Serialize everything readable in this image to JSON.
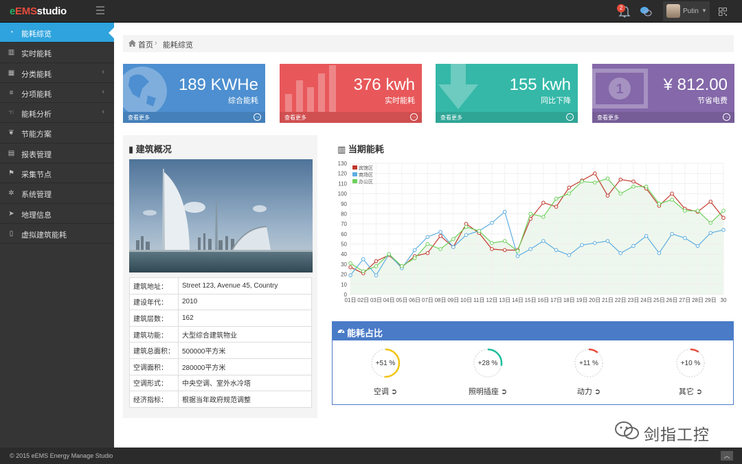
{
  "app": {
    "logo_e": "e",
    "logo_ems": "EMS",
    "logo_studio": "studio"
  },
  "topbar": {
    "notification_count": "2",
    "username": "Putin"
  },
  "sidebar": {
    "items": [
      {
        "label": "能耗综览",
        "icon": "dashboard-icon",
        "active": true
      },
      {
        "label": "实时能耗",
        "icon": "bar-chart-icon"
      },
      {
        "label": "分类能耗",
        "icon": "grid-icon",
        "chevron": "‹"
      },
      {
        "label": "分项能耗",
        "icon": "list-icon",
        "chevron": "‹"
      },
      {
        "label": "能耗分析",
        "icon": "hand-icon",
        "chevron": "‹"
      },
      {
        "label": "节能方案",
        "icon": "leaf-icon"
      },
      {
        "label": "报表管理",
        "icon": "table-icon"
      },
      {
        "label": "采集节点",
        "icon": "flag-icon"
      },
      {
        "label": "系统管理",
        "icon": "gear-icon"
      },
      {
        "label": "地理信息",
        "icon": "location-arrow-icon"
      },
      {
        "label": "虚拟建筑能耗",
        "icon": "building-icon"
      }
    ]
  },
  "breadcrumb": {
    "home": "首页",
    "separator": "›",
    "current": "能耗综览"
  },
  "tiles": [
    {
      "value": "189 KWHe",
      "label": "综合能耗",
      "more": "查看更多",
      "color": "#4d8fd0",
      "icon": "globe-icon"
    },
    {
      "value": "376 kwh",
      "label": "实时能耗",
      "more": "查看更多",
      "color": "#e8585a",
      "icon": "bar-chart-icon"
    },
    {
      "value": "155 kwh",
      "label": "同比下降",
      "more": "查看更多",
      "color": "#35b8a8",
      "icon": "arrow-down-icon"
    },
    {
      "value": "¥ 812.00",
      "label": "节省电费",
      "more": "查看更多",
      "color": "#8468a9",
      "icon": "money-icon"
    }
  ],
  "building": {
    "title": "建筑概况",
    "rows": [
      {
        "key": "建筑地址：",
        "value": "Street 123, Avenue 45, Country"
      },
      {
        "key": "建设年代：",
        "value": "2010"
      },
      {
        "key": "建筑层数：",
        "value": "162"
      },
      {
        "key": "建筑功能：",
        "value": "大型综合建筑物业"
      },
      {
        "key": "建筑总面积：",
        "value": "500000平方米"
      },
      {
        "key": "空调面积：",
        "value": "280000平方米"
      },
      {
        "key": "空调形式：",
        "value": "中央空调、室外水冷塔"
      },
      {
        "key": "经济指标：",
        "value": "根据当年政府规范调整"
      }
    ]
  },
  "line_panel": {
    "title": "当期能耗"
  },
  "ratio_panel": {
    "title": "能耗占比",
    "gauges": [
      {
        "pct_text": "+51 %",
        "value": 51,
        "label": "空调",
        "color": "#f1c40f"
      },
      {
        "pct_text": "+28 %",
        "value": 28,
        "label": "照明插座",
        "color": "#1abc9c"
      },
      {
        "pct_text": "+11 %",
        "value": 11,
        "label": "动力",
        "color": "#e74c3c"
      },
      {
        "pct_text": "+10 %",
        "value": 10,
        "label": "其它",
        "color": "#e74c3c"
      }
    ]
  },
  "footer": {
    "copyright": "© 2015 eEMS Energy Manage Studio",
    "up": "︿"
  },
  "watermark": {
    "text": "剑指工控"
  },
  "chart_data": {
    "type": "line",
    "categories": [
      "01日",
      "02日",
      "03日",
      "04日",
      "05日",
      "06日",
      "07日",
      "08日",
      "09日",
      "10日",
      "11日",
      "12日",
      "13日",
      "14日",
      "15日",
      "16日",
      "17日",
      "18日",
      "19日",
      "20日",
      "21日",
      "22日",
      "23日",
      "24日",
      "25日",
      "26日",
      "27日",
      "28日",
      "29日",
      "30"
    ],
    "ylim": [
      0,
      130
    ],
    "yticks": [
      0,
      10,
      20,
      30,
      40,
      50,
      60,
      70,
      80,
      90,
      100,
      110,
      120,
      130
    ],
    "grid": true,
    "legend_position": "top-left",
    "series": [
      {
        "name": "宾馆区",
        "color": "#c0392b",
        "values": [
          27,
          21,
          33,
          39,
          27,
          38,
          41,
          58,
          47,
          70,
          61,
          45,
          44,
          44,
          75,
          91,
          87,
          106,
          113,
          120,
          98,
          114,
          112,
          105,
          88,
          100,
          85,
          82,
          92,
          76
        ]
      },
      {
        "name": "商场区",
        "color": "#5dade2",
        "values": [
          19,
          35,
          19,
          40,
          26,
          44,
          57,
          62,
          47,
          59,
          63,
          71,
          82,
          38,
          45,
          53,
          44,
          39,
          49,
          51,
          53,
          41,
          48,
          58,
          41,
          60,
          56,
          48,
          61,
          64
        ]
      },
      {
        "name": "办公区",
        "color": "#6ed05c",
        "values": [
          31,
          23,
          28,
          40,
          28,
          36,
          50,
          45,
          55,
          67,
          63,
          51,
          53,
          43,
          80,
          77,
          95,
          100,
          112,
          111,
          115,
          100,
          107,
          107,
          90,
          94,
          83,
          83,
          71,
          83
        ]
      }
    ]
  }
}
